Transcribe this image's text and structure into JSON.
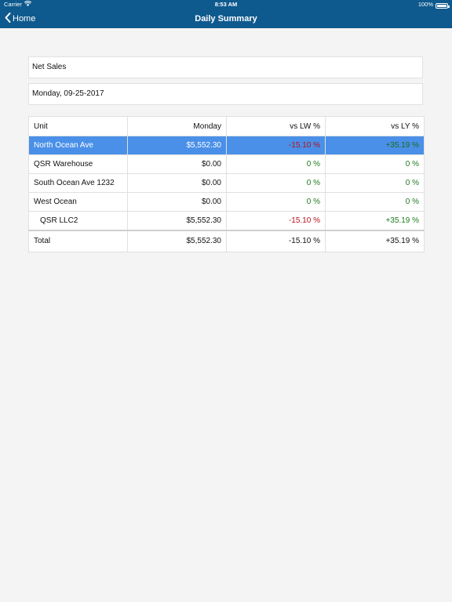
{
  "status_bar": {
    "carrier": "Carrier",
    "time": "8:53 AM",
    "battery": "100%"
  },
  "nav": {
    "back_label": "Home",
    "title": "Daily Summary"
  },
  "metric_field": {
    "value": "Net Sales"
  },
  "date_field": {
    "value": "Monday, 09-25-2017"
  },
  "table": {
    "headers": [
      "Unit",
      "Monday",
      "vs LW %",
      "vs LY %"
    ],
    "rows": [
      {
        "unit": "North Ocean Ave",
        "monday": "$5,552.30",
        "vs_lw": "-15.10 %",
        "vs_ly": "+35.19 %"
      },
      {
        "unit": "QSR Warehouse",
        "monday": "$0.00",
        "vs_lw": "0 %",
        "vs_ly": "0 %"
      },
      {
        "unit": "South Ocean Ave 1232",
        "monday": "$0.00",
        "vs_lw": "0 %",
        "vs_ly": "0 %"
      },
      {
        "unit": "West Ocean",
        "monday": "$0.00",
        "vs_lw": "0 %",
        "vs_ly": "0 %"
      },
      {
        "unit": "QSR LLC2",
        "monday": "$5,552.30",
        "vs_lw": "-15.10 %",
        "vs_ly": "+35.19 %"
      }
    ],
    "total": {
      "unit": "Total",
      "monday": "$5,552.30",
      "vs_lw": "-15.10 %",
      "vs_ly": "+35.19 %"
    }
  },
  "colors": {
    "nav_bar": "#0e5a8e",
    "selected_row": "#4a90e8",
    "negative": "#b5121b",
    "positive": "#1e7a1e"
  }
}
